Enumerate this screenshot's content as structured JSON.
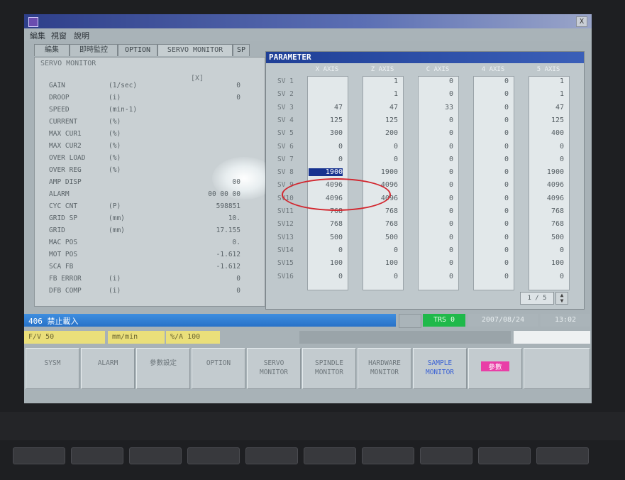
{
  "window": {
    "title": "",
    "close": "X"
  },
  "menu": [
    "編集",
    "視窗",
    "說明"
  ],
  "tabs": [
    "編集",
    "即時監控",
    "OPTION",
    "SERVO MONITOR",
    "SP"
  ],
  "servo": {
    "title": "SERVO MONITOR",
    "col_head": "[X]",
    "rows": [
      {
        "label": "GAIN",
        "unit": "(1/sec)",
        "value": "0"
      },
      {
        "label": "DROOP",
        "unit": "(i)",
        "value": "0"
      },
      {
        "label": "SPEED",
        "unit": "(min-1)",
        "value": ""
      },
      {
        "label": "CURRENT",
        "unit": "(%)",
        "value": ""
      },
      {
        "label": "MAX CUR1",
        "unit": "(%)",
        "value": ""
      },
      {
        "label": "MAX CUR2",
        "unit": "(%)",
        "value": ""
      },
      {
        "label": "OVER LOAD",
        "unit": "(%)",
        "value": ""
      },
      {
        "label": "OVER REG",
        "unit": "(%)",
        "value": ""
      },
      {
        "label": "AMP DISP",
        "unit": "",
        "value": "00"
      },
      {
        "label": "ALARM",
        "unit": "",
        "value": "00 00 00"
      },
      {
        "label": "CYC CNT",
        "unit": "(P)",
        "value": "598851"
      },
      {
        "label": "GRID SP",
        "unit": "(mm)",
        "value": "10."
      },
      {
        "label": "GRID",
        "unit": "(mm)",
        "value": "17.155"
      },
      {
        "label": "MAC POS",
        "unit": "",
        "value": "0."
      },
      {
        "label": "MOT POS",
        "unit": "",
        "value": "-1.612"
      },
      {
        "label": "SCA FB",
        "unit": "",
        "value": "-1.612"
      },
      {
        "label": "FB ERROR",
        "unit": "(i)",
        "value": "0"
      },
      {
        "label": "DFB COMP",
        "unit": "(i)",
        "value": "0"
      }
    ]
  },
  "param": {
    "title": "PARAMETER",
    "axes": [
      "X AXIS",
      "Z AXIS",
      "C AXIS",
      "4 AXIS",
      "5 AXIS"
    ],
    "row_labels": [
      "SV 1",
      "SV 2",
      "SV 3",
      "SV 4",
      "SV 5",
      "SV 6",
      "SV 7",
      "SV 8",
      "SV 9",
      "SV10",
      "SV11",
      "SV12",
      "SV13",
      "SV14",
      "SV15",
      "SV16"
    ],
    "columns": [
      [
        "",
        "",
        "47",
        "125",
        "300",
        "0",
        "0",
        "1900",
        "4096",
        "4096",
        "768",
        "768",
        "500",
        "0",
        "100",
        "0"
      ],
      [
        "1",
        "1",
        "47",
        "125",
        "200",
        "0",
        "0",
        "1900",
        "4096",
        "4096",
        "768",
        "768",
        "500",
        "0",
        "100",
        "0"
      ],
      [
        "0",
        "0",
        "33",
        "0",
        "0",
        "0",
        "0",
        "0",
        "0",
        "0",
        "0",
        "0",
        "0",
        "0",
        "0",
        "0"
      ],
      [
        "0",
        "0",
        "0",
        "0",
        "0",
        "0",
        "0",
        "0",
        "0",
        "0",
        "0",
        "0",
        "0",
        "0",
        "0",
        "0"
      ],
      [
        "1",
        "1",
        "47",
        "125",
        "400",
        "0",
        "0",
        "1900",
        "4096",
        "4096",
        "768",
        "768",
        "500",
        "0",
        "100",
        "0"
      ]
    ],
    "page": "1 / 5"
  },
  "status": {
    "alarm": "406 禁止載入",
    "trs": "TRS 0",
    "date": "2007/08/24",
    "time": "13:02"
  },
  "overrides": {
    "fov_label": "F/V 50",
    "feed_unit": "mm/min",
    "ovr_label": "%/A 100"
  },
  "fkeys": [
    "SYSM",
    "ALARM",
    "參數設定",
    "OPTION",
    "SERVO MONITOR",
    "SPINDLE MONITOR",
    "HARDWARE MONITOR",
    "SAMPLE MONITOR",
    "參數",
    ""
  ],
  "colors": {
    "accent": "#17328f",
    "alarm": "#2872c8",
    "trs": "#1fb94a",
    "highlight": "#d2262e"
  }
}
